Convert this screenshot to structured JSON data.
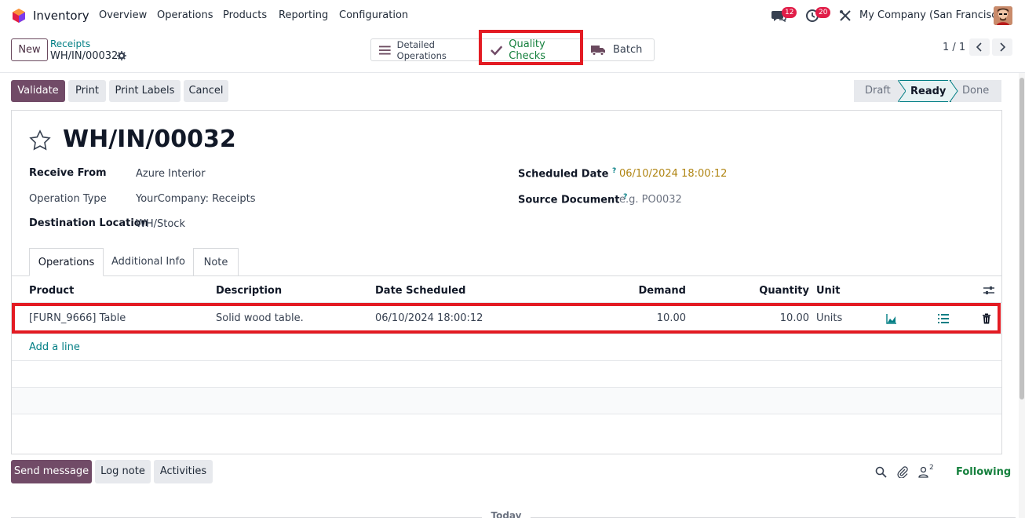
{
  "navbar": {
    "app_name": "Inventory",
    "menu": [
      "Overview",
      "Operations",
      "Products",
      "Reporting",
      "Configuration"
    ],
    "messages_count": "12",
    "activities_count": "20",
    "company": "My Company (San Francisco)"
  },
  "control_panel": {
    "new_label": "New",
    "breadcrumb_parent": "Receipts",
    "breadcrumb_current": "WH/IN/00032",
    "smart_buttons": {
      "detailed": "Detailed Operations",
      "quality": "Quality Checks",
      "batch": "Batch"
    },
    "pager": "1 / 1"
  },
  "actions": {
    "validate": "Validate",
    "print": "Print",
    "print_labels": "Print Labels",
    "cancel": "Cancel"
  },
  "statusbar": {
    "stages": [
      "Draft",
      "Ready",
      "Done"
    ],
    "active": "Ready"
  },
  "record": {
    "title": "WH/IN/00032",
    "receive_from_label": "Receive From",
    "receive_from": "Azure Interior",
    "operation_type_label": "Operation Type",
    "operation_type": "YourCompany: Receipts",
    "destination_label": "Destination Location",
    "destination": "WH/Stock",
    "scheduled_date_label": "Scheduled Date",
    "scheduled_date": "06/10/2024 18:00:12",
    "source_document_label": "Source Document",
    "source_document_placeholder": "e.g. PO0032",
    "help_mark": "?"
  },
  "tabs": [
    "Operations",
    "Additional Info",
    "Note"
  ],
  "table": {
    "headers": {
      "product": "Product",
      "description": "Description",
      "date": "Date Scheduled",
      "demand": "Demand",
      "quantity": "Quantity",
      "unit": "Unit"
    },
    "rows": [
      {
        "product": "[FURN_9666] Table",
        "description": "Solid wood table.",
        "date": "06/10/2024 18:00:12",
        "demand": "10.00",
        "quantity": "10.00",
        "unit": "Units"
      }
    ],
    "add_line": "Add a line"
  },
  "chatter": {
    "send_message": "Send message",
    "log_note": "Log note",
    "activities": "Activities",
    "followers": "2",
    "following": "Following",
    "today": "Today"
  },
  "colors": {
    "primary": "#714b67",
    "link": "#017e84",
    "highlight": "#e31b23",
    "success": "#15803d"
  }
}
